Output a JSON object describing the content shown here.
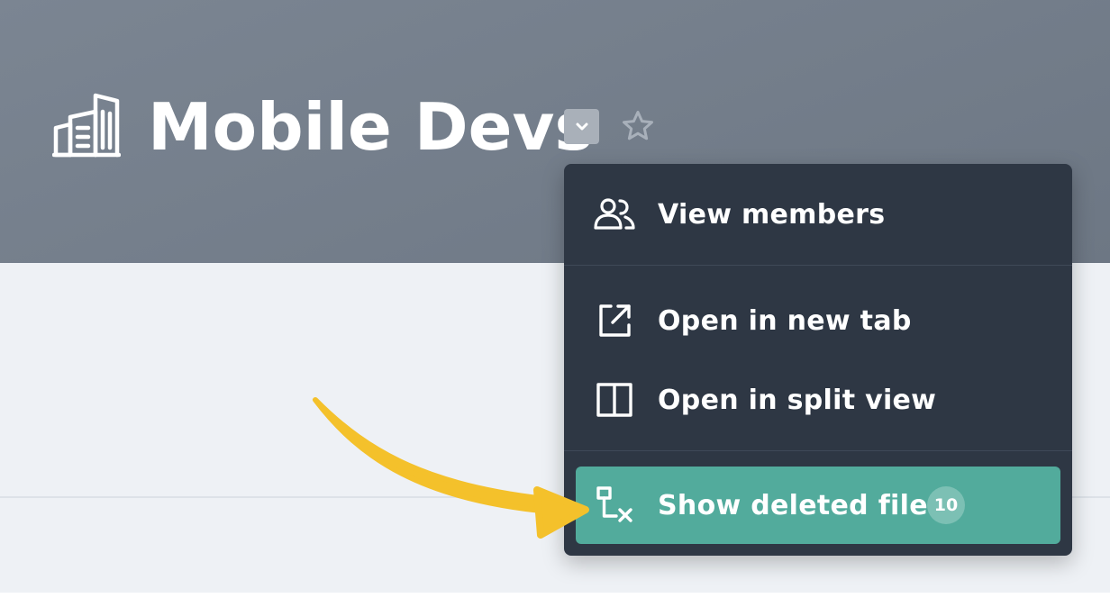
{
  "header": {
    "title": "Mobile Devs",
    "icon": "building-icon",
    "dropdown_icon": "chevron-down-icon",
    "favorite_icon": "star-icon"
  },
  "menu": {
    "items": [
      {
        "label": "View members",
        "icon": "members-icon"
      },
      {
        "label": "Open in new tab",
        "icon": "external-link-icon"
      },
      {
        "label": "Open in split view",
        "icon": "split-view-icon"
      },
      {
        "label": "Show deleted files",
        "icon": "deleted-files-icon",
        "badge": "10",
        "highlighted": true
      }
    ]
  },
  "annotation": {
    "icon": "arrow-icon",
    "color": "#f4c12b"
  },
  "colors": {
    "header_bg": "#737d8a",
    "menu_bg": "#2e3744",
    "highlight": "#52ab9c",
    "page_bg": "#eef1f5"
  }
}
